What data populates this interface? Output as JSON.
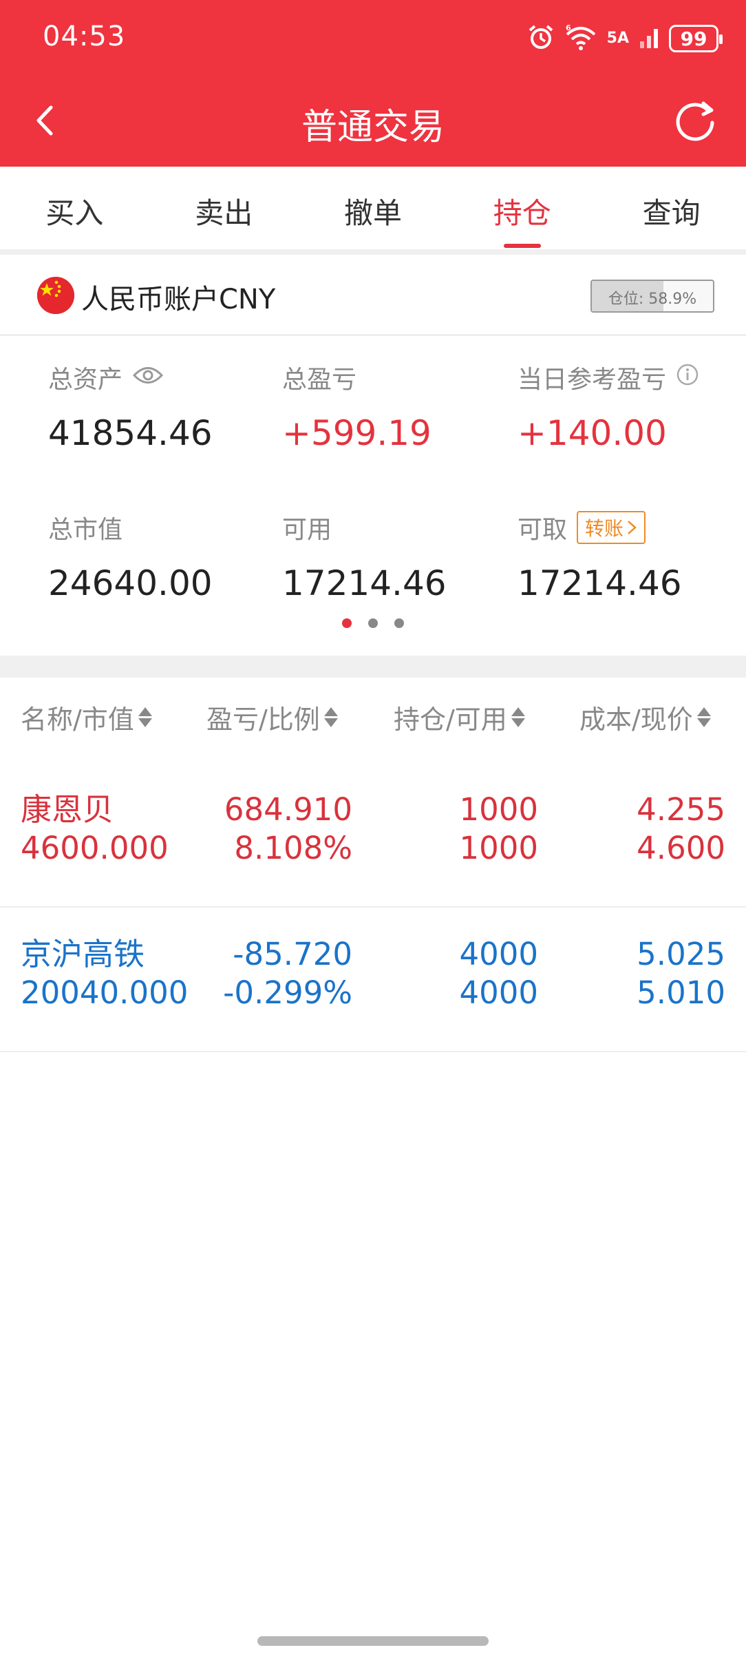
{
  "status_bar": {
    "time": "04:53",
    "network": "5A",
    "wifi_label": "6",
    "battery": "99"
  },
  "nav": {
    "title": "普通交易"
  },
  "tabs": [
    {
      "label": "买入",
      "active": false
    },
    {
      "label": "卖出",
      "active": false
    },
    {
      "label": "撤单",
      "active": false
    },
    {
      "label": "持仓",
      "active": true
    },
    {
      "label": "查询",
      "active": false
    }
  ],
  "account": {
    "name": "人民币账户CNY",
    "position_label": "仓位:",
    "position_value": "58.9%",
    "position_fraction": 0.589
  },
  "summary": {
    "total_assets": {
      "label": "总资产",
      "value": "41854.46"
    },
    "total_pl": {
      "label": "总盈亏",
      "value": "+599.19"
    },
    "daily_pl": {
      "label": "当日参考盈亏",
      "value": "+140.00"
    },
    "market_value": {
      "label": "总市值",
      "value": "24640.00"
    },
    "available": {
      "label": "可用",
      "value": "17214.46"
    },
    "withdrawable": {
      "label": "可取",
      "value": "17214.46",
      "transfer_label": "转账"
    },
    "page_indicator": {
      "count": 3,
      "active": 0
    }
  },
  "holdings": {
    "columns": [
      "名称/市值",
      "盈亏/比例",
      "持仓/可用",
      "成本/现价"
    ],
    "rows": [
      {
        "name": "康恩贝",
        "market_value": "4600.000",
        "pl": "684.910",
        "pl_ratio": "8.108%",
        "holding": "1000",
        "available": "1000",
        "cost": "4.255",
        "price": "4.600",
        "trend": "gain"
      },
      {
        "name": "京沪高铁",
        "market_value": "20040.000",
        "pl": "-85.720",
        "pl_ratio": "-0.299%",
        "holding": "4000",
        "available": "4000",
        "cost": "5.025",
        "price": "5.010",
        "trend": "loss"
      }
    ]
  },
  "colors": {
    "brand_red": "#ef333f",
    "gain": "#d9323c",
    "loss": "#1a73c9",
    "transfer_orange": "#f08a24"
  }
}
